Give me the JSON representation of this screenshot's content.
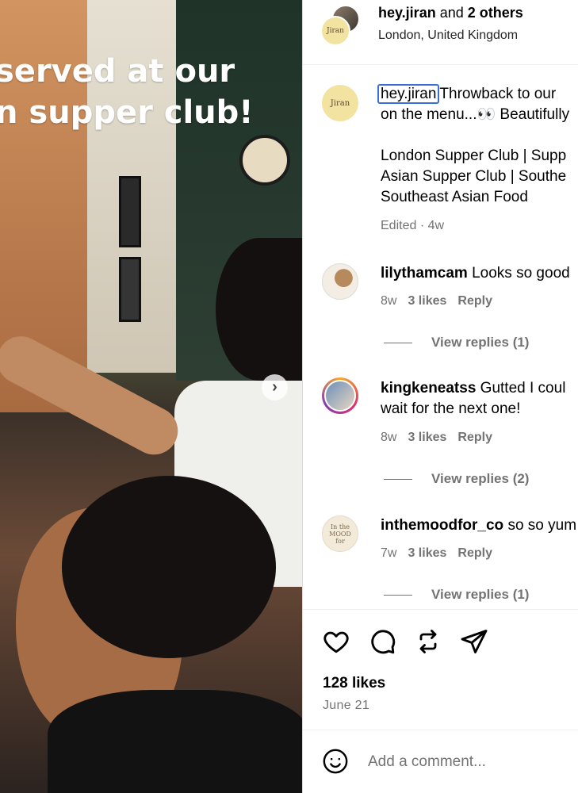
{
  "photo": {
    "overlay_line1": "served at our",
    "overlay_line2": "n supper club!",
    "next_icon": "chevron-right-icon"
  },
  "header": {
    "username": "hey.jiran",
    "and_text": " and ",
    "others": "2 others",
    "location": "London, United Kingdom",
    "avatar_text": "Jiran"
  },
  "caption": {
    "username": "hey.jiran",
    "text_line1": "Throwback to our",
    "text_line2": "on the menu...👀 Beautifully",
    "hashtags": [
      "London Supper Club | Supp",
      "Asian Supper Club | Southe",
      "Southeast Asian Food"
    ],
    "meta": "Edited · 4w"
  },
  "comments": [
    {
      "username": "lilythamcam",
      "text": " Looks so good",
      "line2": "",
      "age": "8w",
      "likes": "3 likes",
      "reply": "Reply",
      "view_replies": "View replies (1)"
    },
    {
      "username": "kingkeneatss",
      "text": " Gutted I coul",
      "line2": "wait for the next one!",
      "age": "8w",
      "likes": "3 likes",
      "reply": "Reply",
      "view_replies": "View replies (2)"
    },
    {
      "username": "inthemoodfor_co",
      "text": " so so yum",
      "line2": "",
      "age": "7w",
      "likes": "3 likes",
      "reply": "Reply",
      "view_replies": "View replies (1)",
      "avatar_text": "In the MOOD for"
    }
  ],
  "actions": {
    "icons": [
      "heart-icon",
      "comment-icon",
      "repost-icon",
      "share-icon"
    ],
    "likes": "128 likes",
    "date": "June 21"
  },
  "comment_bar": {
    "placeholder": "Add a comment...",
    "emoji_icon": "emoji-icon"
  }
}
